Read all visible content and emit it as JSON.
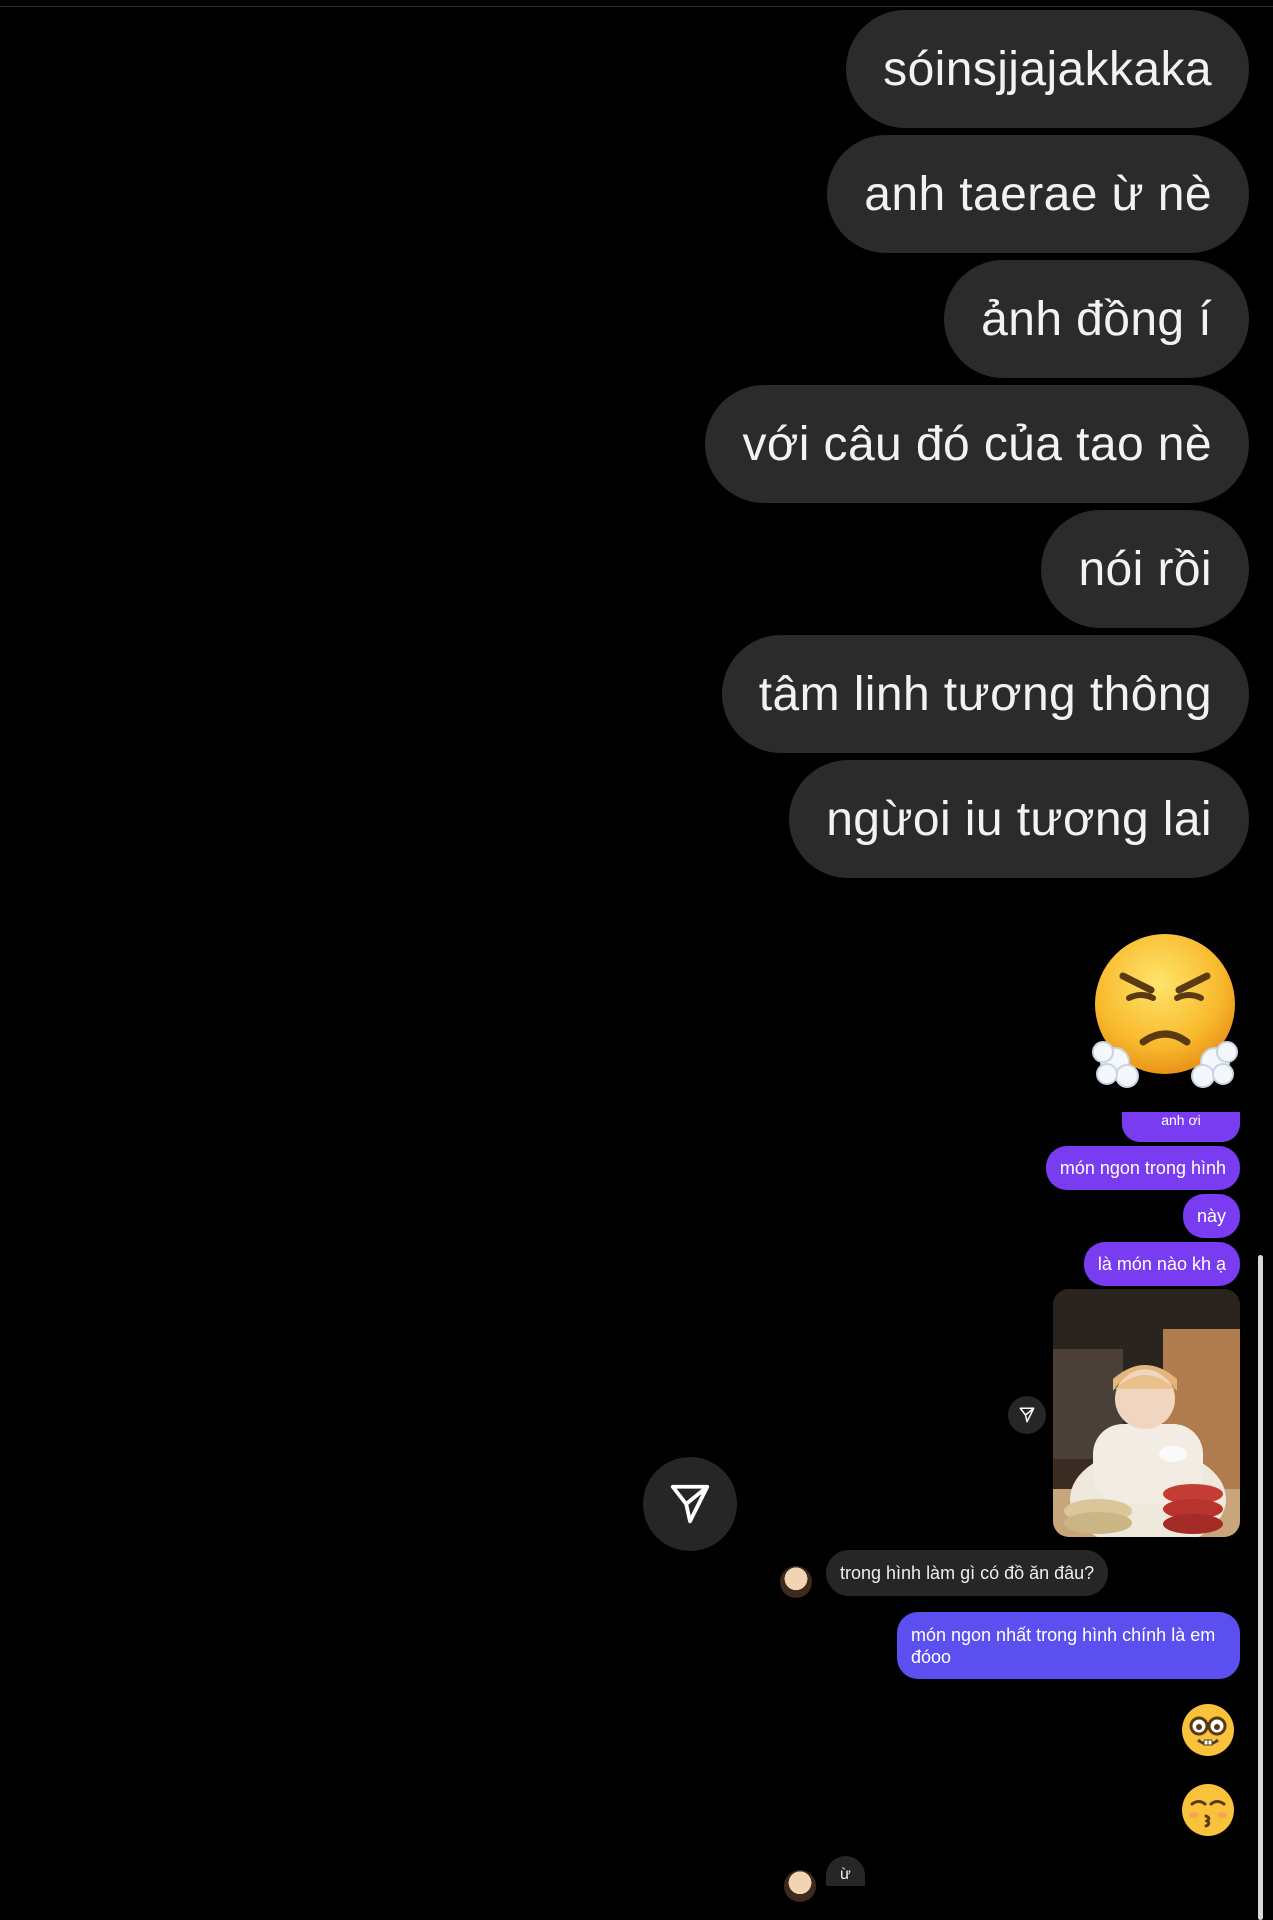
{
  "messages_large": [
    "sóinsjjajakkaka",
    "anh taerae ừ nè",
    "ảnh đồng í",
    "với câu đó của tao nè",
    "nói rồi",
    "tâm linh tương thông",
    "ngừoi iu tương lai"
  ],
  "emoji_large": "steam-from-nose-emoji",
  "embedded_chat": {
    "cut_top_bubble": "anh ơi",
    "purple_messages": [
      "món ngon trong hình",
      "này",
      "là món nào kh ạ"
    ],
    "reply_gray": "trong hình làm gì có đồ ăn đâu?",
    "blue_message_line1": "món ngon nhất trong hình chính là em",
    "blue_message_line2": "đóoo",
    "emoji_1": "nerd-face-emoji",
    "emoji_2": "kissing-face-emoji",
    "last_reply": "ừ"
  },
  "colors": {
    "background": "#000000",
    "bubble_gray": "#2b2b2b",
    "sent_purple": "#7a3cf0",
    "sent_blue": "#5b4ff0"
  }
}
